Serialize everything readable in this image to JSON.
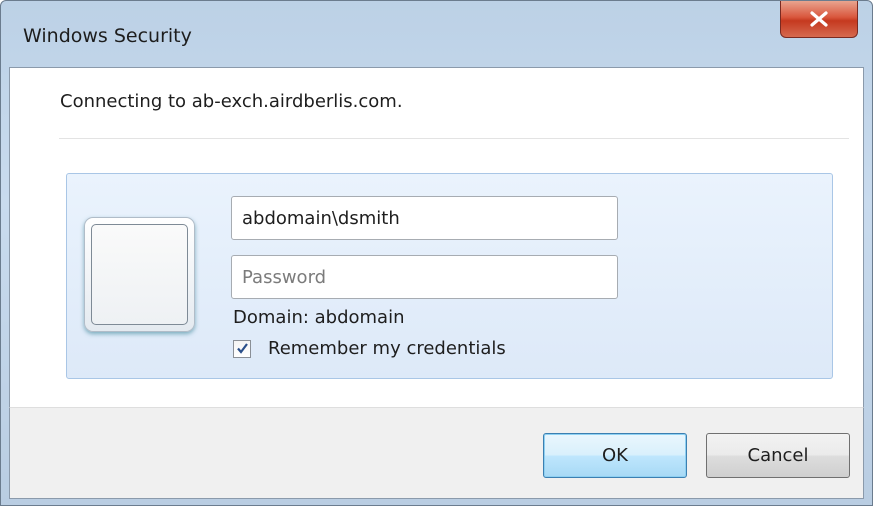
{
  "window": {
    "title": "Windows Security"
  },
  "icons": {
    "close": "close-icon",
    "user_tile": "user-tile-icon",
    "checkmark": "checkmark-icon"
  },
  "colors": {
    "close_button": "#c5391f",
    "tile_background": "#dde9f8",
    "ok_button_border": "#3c7fb1"
  },
  "message": {
    "connecting": "Connecting to ab-exch.airdberlis.com."
  },
  "credentials": {
    "username_value": "abdomain\\dsmith",
    "password_placeholder": "Password",
    "domain_label": "Domain: abdomain",
    "remember_label": "Remember my credentials",
    "remember_checked": true
  },
  "buttons": {
    "ok_label": "OK",
    "cancel_label": "Cancel"
  }
}
